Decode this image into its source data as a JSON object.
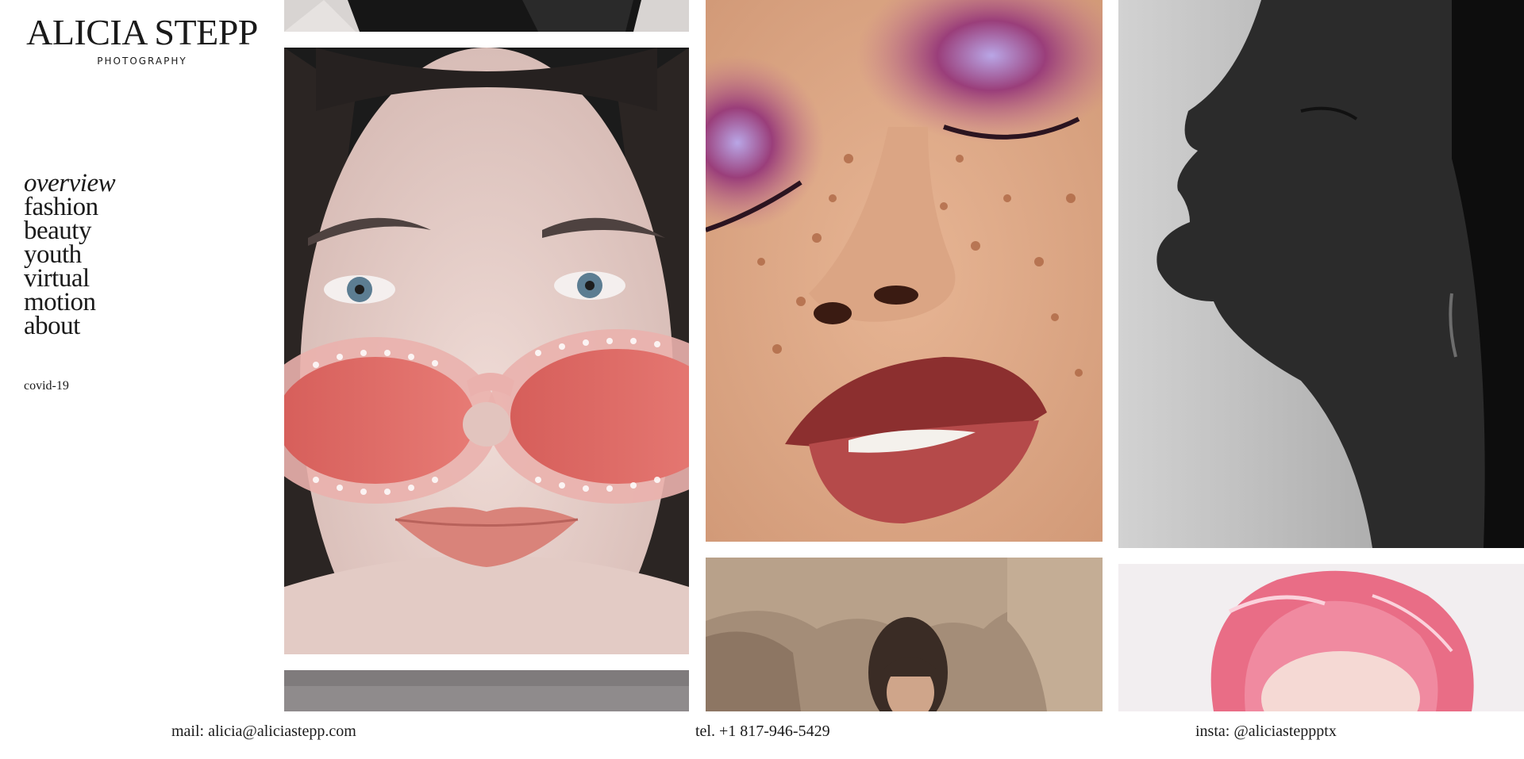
{
  "brand": {
    "name": "ALICIA STEPP",
    "tagline": "PHOTOGRAPHY"
  },
  "nav": {
    "items": [
      {
        "label": "overview",
        "active": true
      },
      {
        "label": "fashion"
      },
      {
        "label": "beauty"
      },
      {
        "label": "youth"
      },
      {
        "label": "virtual"
      },
      {
        "label": "motion"
      },
      {
        "label": "about"
      }
    ],
    "secondary": "covid-19"
  },
  "gallery": {
    "photos": [
      {
        "name": "photo-black-top"
      },
      {
        "name": "photo-pink-sunglasses"
      },
      {
        "name": "photo-grey-partial"
      },
      {
        "name": "photo-glitter-eyeshadow-freckles"
      },
      {
        "name": "photo-rock-portrait"
      },
      {
        "name": "photo-bw-profile"
      },
      {
        "name": "photo-pink-plastic-hood"
      }
    ]
  },
  "footer": {
    "mail": "mail: alicia@aliciastepp.com",
    "tel": "tel. +1 817-946-5429",
    "insta": "insta: @aliciasteppptx"
  },
  "colors": {
    "text": "#1a1a1a",
    "background": "#ffffff"
  }
}
